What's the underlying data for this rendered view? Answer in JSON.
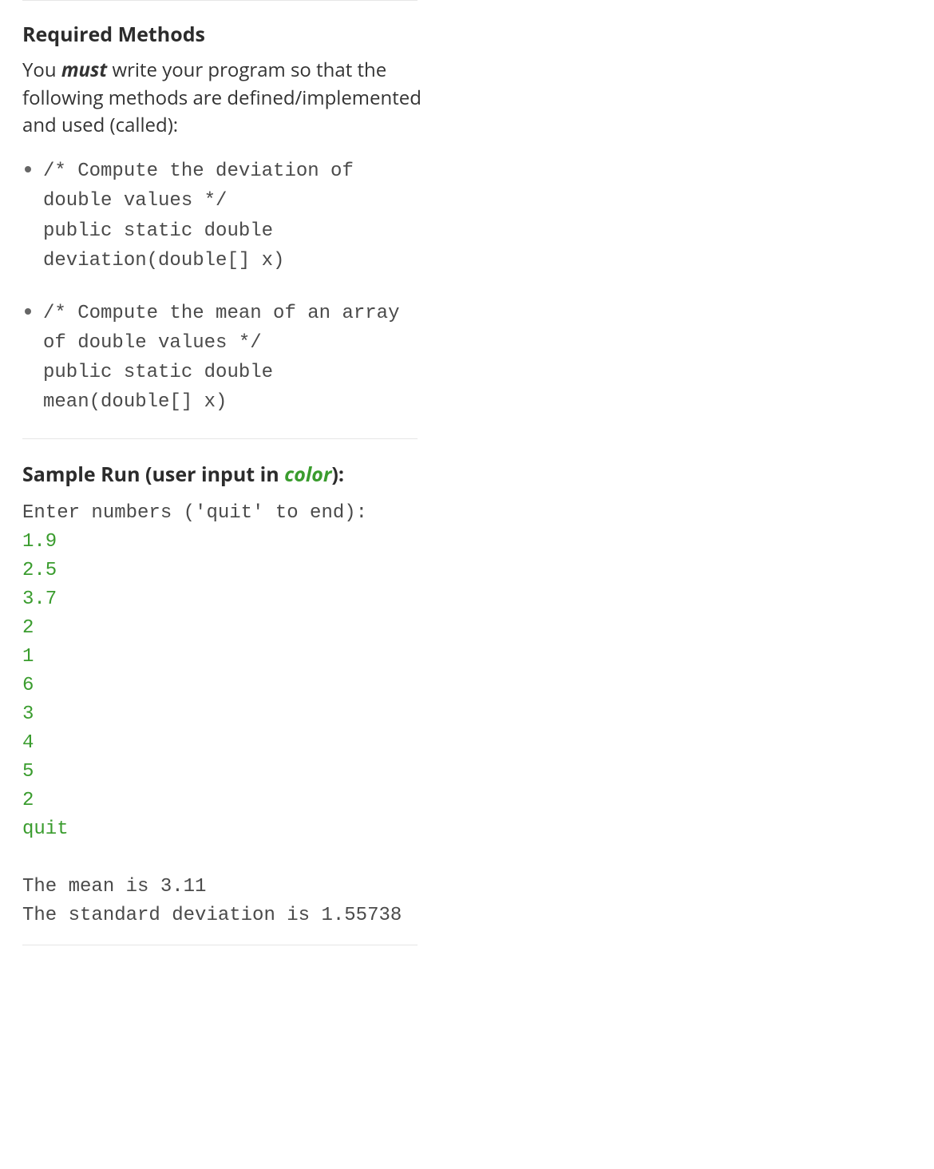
{
  "section1": {
    "heading": "Required Methods",
    "intro_prefix": "You ",
    "intro_must": "must",
    "intro_rest": " write your program so that the following methods are defined/implemented and used (called):",
    "methods": [
      "/* Compute the deviation of double values */\npublic static double deviation(double[] x)",
      "/* Compute the mean of an array of double values */\npublic static double mean(double[] x)"
    ]
  },
  "section2": {
    "heading_prefix": "Sample Run (user input in ",
    "heading_color_word": "color",
    "heading_suffix": "):",
    "run": {
      "prompt": "Enter numbers ('quit' to end):",
      "inputs": [
        "1.9",
        "2.5",
        "3.7",
        "2",
        "1",
        "6",
        "3",
        "4",
        "5",
        "2",
        "quit"
      ],
      "output1": "The mean is 3.11",
      "output2": "The standard deviation is 1.55738"
    }
  }
}
